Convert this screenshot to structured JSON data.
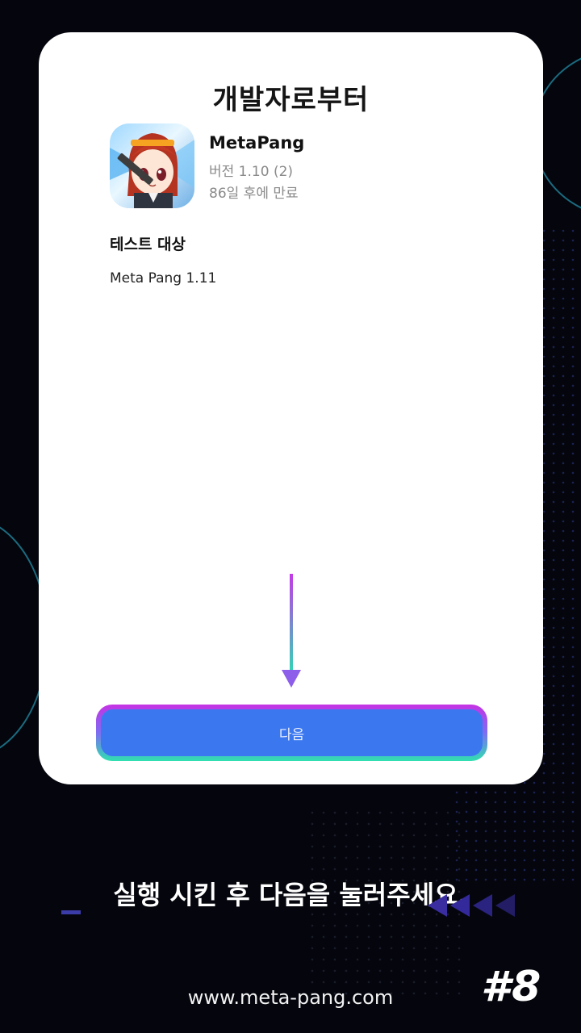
{
  "card": {
    "title": "개발자로부터",
    "app": {
      "name": "MetaPang",
      "version": "버전 1.10 (2)",
      "expiry": "86일 후에 만료"
    },
    "section_title": "테스트 대상",
    "section_body": "Meta Pang 1.11",
    "next_button_label": "다음"
  },
  "caption": "실행 시킨 후 다음을 눌러주세요.",
  "footer": {
    "url": "www.meta-pang.com",
    "step_badge": "#8"
  },
  "colors": {
    "button": "#3b78f0",
    "gradient_top": "#c533e4",
    "gradient_bottom": "#2fe0b0",
    "background": "#05060d"
  },
  "icons": [
    "app-icon",
    "down-arrow-icon",
    "chevrons-left-icon"
  ]
}
